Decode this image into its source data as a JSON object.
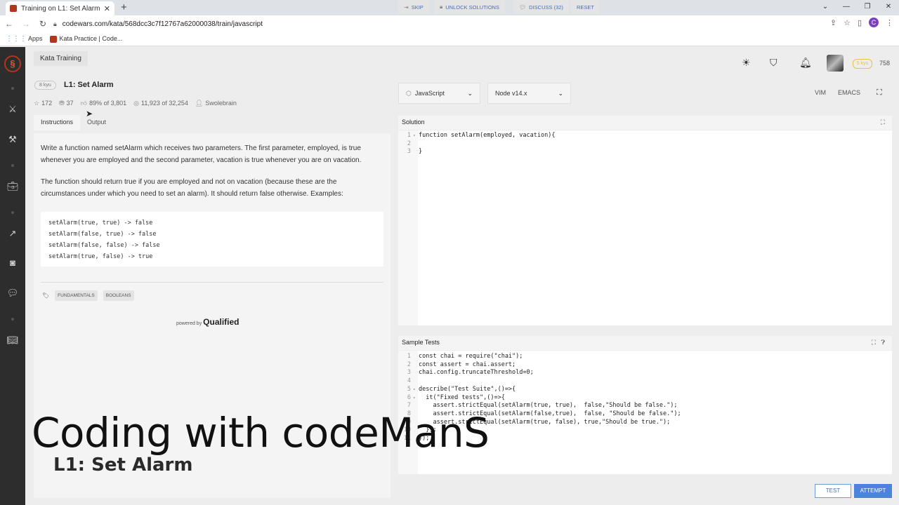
{
  "browser": {
    "tab_title": "Training on L1: Set Alarm | Code...",
    "url": "codewars.com/kata/568dcc3c7f12767a62000038/train/javascript",
    "profile_initial": "C",
    "bookmarks": [
      "Apps",
      "Kata Practice | Code..."
    ]
  },
  "header": {
    "section_tag": "Kata Training",
    "rank": "5 kyu",
    "honor": "758"
  },
  "kata": {
    "kyu": "8 kyu",
    "title": "L1: Set Alarm",
    "stats": {
      "stars": "172",
      "collections": "37",
      "satisfaction": "89% of 3,801",
      "completed": "11,923 of 32,254",
      "author": "Swolebrain"
    },
    "tabs": [
      "Instructions",
      "Output"
    ]
  },
  "instructions": {
    "p1": "Write a function named setAlarm which receives two parameters. The first parameter, employed, is true whenever you are employed and the second parameter, vacation is true whenever you are on vacation.",
    "p2": "The function should return true if you are employed and not on vacation (because these are the circumstances under which you need to set an alarm). It should return false otherwise. Examples:",
    "examples": [
      "setAlarm(true, true) -> false",
      "setAlarm(false, true) -> false",
      "setAlarm(false, false) -> false",
      "setAlarm(true, false) -> true"
    ],
    "tags": [
      "FUNDAMENTALS",
      "BOOLEANS"
    ],
    "powered_prefix": "powered by",
    "powered_brand": "Qualified"
  },
  "editor": {
    "language": "JavaScript",
    "runtime": "Node v14.x",
    "modes": [
      "VIM",
      "EMACS"
    ],
    "solution_label": "Solution",
    "solution_lines": [
      "function setAlarm(employed, vacation){",
      "",
      "}"
    ],
    "tests_label": "Sample Tests",
    "test_lines": [
      "const chai = require(\"chai\");",
      "const assert = chai.assert;",
      "chai.config.truncateThreshold=0;",
      "",
      "describe(\"Test Suite\",()=>{",
      "  it(\"Fixed tests\",()=>{",
      "    assert.strictEqual(setAlarm(true, true),  false,\"Should be false.\");",
      "    assert.strictEqual(setAlarm(false,true),  false, \"Should be false.\");",
      "    assert.strictEqual(setAlarm(true, false), true,\"Should be true.\");",
      "  });",
      "});"
    ]
  },
  "actions": {
    "skip": "SKIP",
    "unlock": "UNLOCK SOLUTIONS",
    "discuss": "DISCUSS (32)",
    "reset": "RESET",
    "test": "TEST",
    "attempt": "ATTEMPT"
  },
  "overlay": {
    "channel": "Coding with codeManS",
    "subtitle": "L1: Set Alarm"
  }
}
